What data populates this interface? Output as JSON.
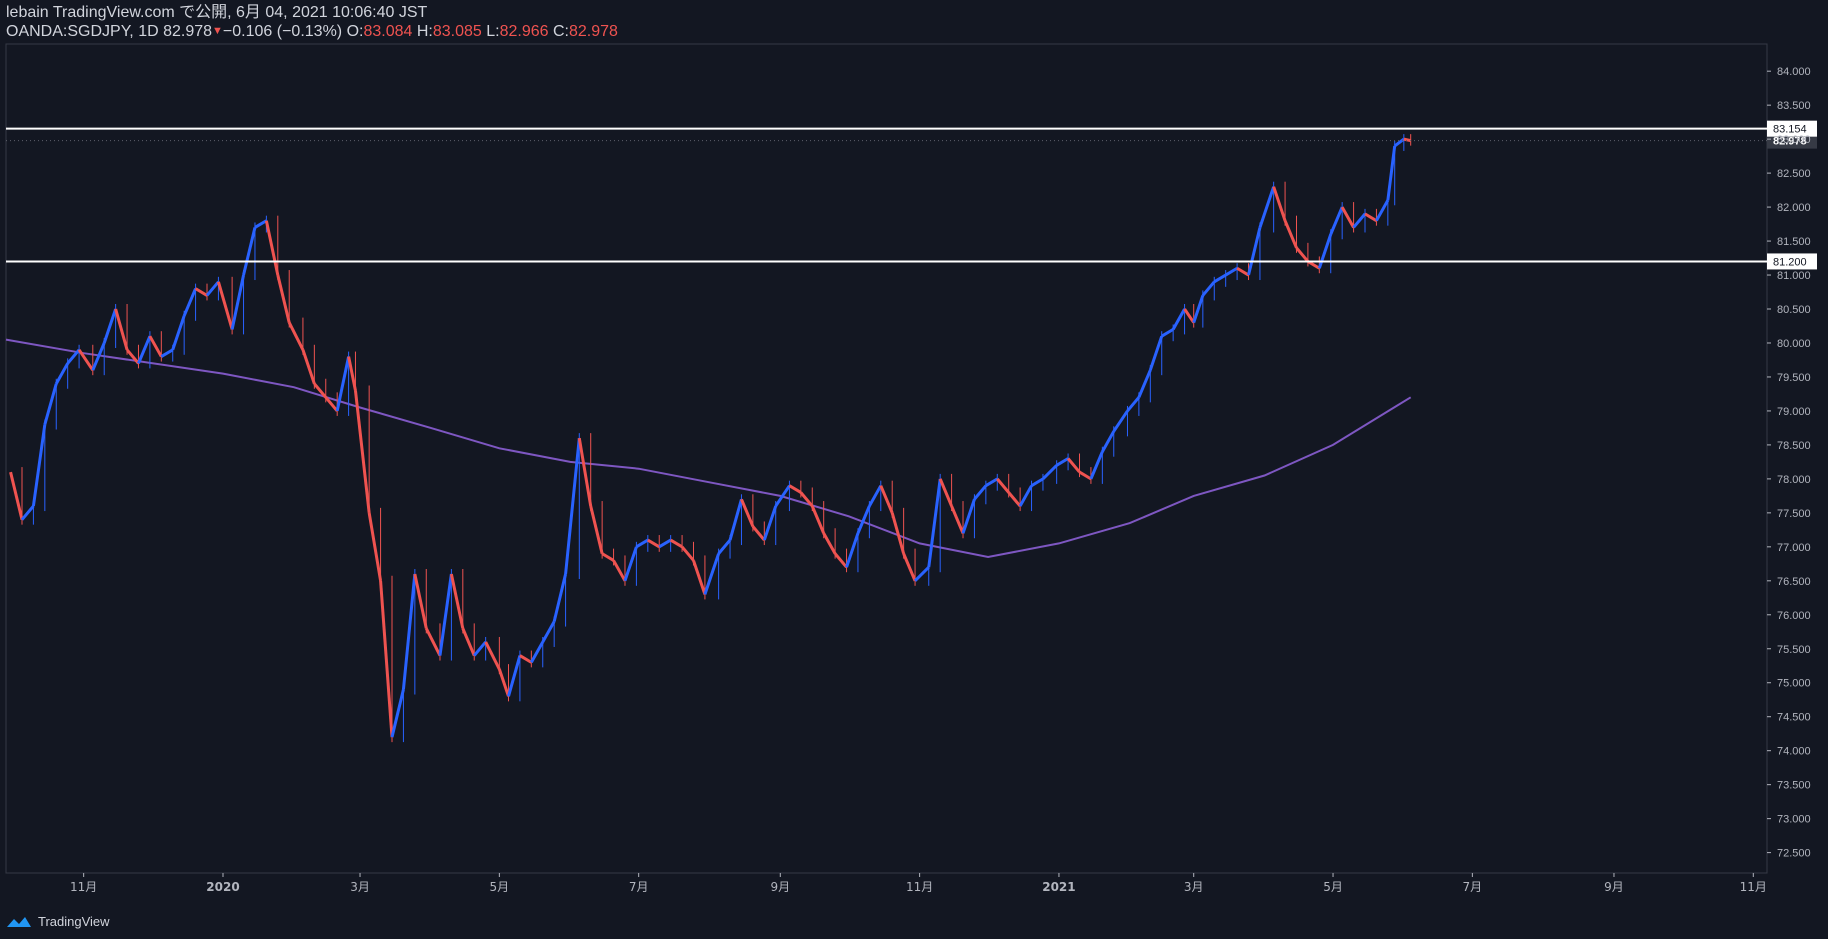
{
  "header": {
    "publish_line": "lebain TradingView.com で公開, 6月 04, 2021 10:06:40 JST",
    "symbol": "OANDA:SGDJPY, 1D",
    "last": "82.978",
    "change": "−0.106 (−0.13%)",
    "o_label": "O:",
    "o_value": "83.084",
    "h_label": "H:",
    "h_value": "83.085",
    "l_label": "L:",
    "l_value": "82.966",
    "c_label": "C:",
    "c_value": "82.978"
  },
  "footer": {
    "brand": "TradingView"
  },
  "colors": {
    "up": "#2962ff",
    "down": "#ef5350",
    "ma": "#7e57c2",
    "bg": "#131722",
    "line": "#ffffff"
  },
  "chart_data": {
    "type": "line",
    "title": "OANDA:SGDJPY, 1D",
    "ylim": [
      72.2,
      84.4
    ],
    "y_ticks": [
      "72.500",
      "73.000",
      "73.500",
      "74.000",
      "74.500",
      "75.000",
      "75.500",
      "76.000",
      "76.500",
      "77.000",
      "77.500",
      "78.000",
      "78.500",
      "79.000",
      "79.500",
      "80.000",
      "80.500",
      "81.000",
      "81.500",
      "82.000",
      "82.500",
      "83.000",
      "83.500",
      "84.000"
    ],
    "x_ticks": [
      {
        "label": "11月",
        "date": "2019-11-01"
      },
      {
        "label": "2020",
        "date": "2020-01-01"
      },
      {
        "label": "3月",
        "date": "2020-03-01"
      },
      {
        "label": "5月",
        "date": "2020-05-01"
      },
      {
        "label": "7月",
        "date": "2020-07-01"
      },
      {
        "label": "9月",
        "date": "2020-09-01"
      },
      {
        "label": "11月",
        "date": "2020-11-01"
      },
      {
        "label": "2021",
        "date": "2021-01-01"
      },
      {
        "label": "3月",
        "date": "2021-03-01"
      },
      {
        "label": "5月",
        "date": "2021-05-01"
      },
      {
        "label": "7月",
        "date": "2021-07-01"
      },
      {
        "label": "9月",
        "date": "2021-09-01"
      },
      {
        "label": "11月",
        "date": "2021-11-01"
      }
    ],
    "x_range": [
      "2019-09-28",
      "2021-11-07"
    ],
    "price_line": {
      "value": 82.978,
      "label": "82.978"
    },
    "horizontal_lines": [
      {
        "value": 83.154,
        "label": "83.154"
      },
      {
        "value": 81.2,
        "label": "81.200"
      }
    ],
    "series": [
      {
        "type": "close",
        "points": [
          [
            "2019-09-30",
            78.1
          ],
          [
            "2019-10-05",
            77.4
          ],
          [
            "2019-10-10",
            77.6
          ],
          [
            "2019-10-15",
            78.8
          ],
          [
            "2019-10-20",
            79.4
          ],
          [
            "2019-10-25",
            79.7
          ],
          [
            "2019-10-30",
            79.9
          ],
          [
            "2019-11-05",
            79.6
          ],
          [
            "2019-11-10",
            80.0
          ],
          [
            "2019-11-15",
            80.5
          ],
          [
            "2019-11-20",
            79.9
          ],
          [
            "2019-11-25",
            79.7
          ],
          [
            "2019-11-30",
            80.1
          ],
          [
            "2019-12-05",
            79.8
          ],
          [
            "2019-12-10",
            79.9
          ],
          [
            "2019-12-15",
            80.4
          ],
          [
            "2019-12-20",
            80.8
          ],
          [
            "2019-12-25",
            80.7
          ],
          [
            "2019-12-30",
            80.9
          ],
          [
            "2020-01-05",
            80.2
          ],
          [
            "2020-01-10",
            81.0
          ],
          [
            "2020-01-15",
            81.7
          ],
          [
            "2020-01-20",
            81.8
          ],
          [
            "2020-01-25",
            81.0
          ],
          [
            "2020-01-30",
            80.3
          ],
          [
            "2020-02-05",
            79.9
          ],
          [
            "2020-02-10",
            79.4
          ],
          [
            "2020-02-15",
            79.2
          ],
          [
            "2020-02-20",
            79.0
          ],
          [
            "2020-02-25",
            79.8
          ],
          [
            "2020-02-28",
            79.3
          ],
          [
            "2020-03-05",
            77.5
          ],
          [
            "2020-03-10",
            76.5
          ],
          [
            "2020-03-15",
            74.2
          ],
          [
            "2020-03-20",
            74.9
          ],
          [
            "2020-03-25",
            76.6
          ],
          [
            "2020-03-30",
            75.8
          ],
          [
            "2020-04-05",
            75.4
          ],
          [
            "2020-04-10",
            76.6
          ],
          [
            "2020-04-15",
            75.8
          ],
          [
            "2020-04-20",
            75.4
          ],
          [
            "2020-04-25",
            75.6
          ],
          [
            "2020-05-01",
            75.2
          ],
          [
            "2020-05-05",
            74.8
          ],
          [
            "2020-05-10",
            75.4
          ],
          [
            "2020-05-15",
            75.3
          ],
          [
            "2020-05-20",
            75.6
          ],
          [
            "2020-05-25",
            75.9
          ],
          [
            "2020-05-30",
            76.6
          ],
          [
            "2020-06-05",
            78.6
          ],
          [
            "2020-06-10",
            77.6
          ],
          [
            "2020-06-15",
            76.9
          ],
          [
            "2020-06-20",
            76.8
          ],
          [
            "2020-06-25",
            76.5
          ],
          [
            "2020-06-30",
            77.0
          ],
          [
            "2020-07-05",
            77.1
          ],
          [
            "2020-07-10",
            77.0
          ],
          [
            "2020-07-15",
            77.1
          ],
          [
            "2020-07-20",
            77.0
          ],
          [
            "2020-07-25",
            76.8
          ],
          [
            "2020-07-30",
            76.3
          ],
          [
            "2020-08-05",
            76.9
          ],
          [
            "2020-08-10",
            77.1
          ],
          [
            "2020-08-15",
            77.7
          ],
          [
            "2020-08-20",
            77.3
          ],
          [
            "2020-08-25",
            77.1
          ],
          [
            "2020-08-30",
            77.6
          ],
          [
            "2020-09-05",
            77.9
          ],
          [
            "2020-09-10",
            77.8
          ],
          [
            "2020-09-15",
            77.6
          ],
          [
            "2020-09-20",
            77.2
          ],
          [
            "2020-09-25",
            76.9
          ],
          [
            "2020-09-30",
            76.7
          ],
          [
            "2020-10-05",
            77.2
          ],
          [
            "2020-10-10",
            77.6
          ],
          [
            "2020-10-15",
            77.9
          ],
          [
            "2020-10-20",
            77.5
          ],
          [
            "2020-10-25",
            76.9
          ],
          [
            "2020-10-30",
            76.5
          ],
          [
            "2020-11-05",
            76.7
          ],
          [
            "2020-11-10",
            78.0
          ],
          [
            "2020-11-15",
            77.6
          ],
          [
            "2020-11-20",
            77.2
          ],
          [
            "2020-11-25",
            77.7
          ],
          [
            "2020-11-30",
            77.9
          ],
          [
            "2020-12-05",
            78.0
          ],
          [
            "2020-12-10",
            77.8
          ],
          [
            "2020-12-15",
            77.6
          ],
          [
            "2020-12-20",
            77.9
          ],
          [
            "2020-12-25",
            78.0
          ],
          [
            "2020-12-31",
            78.2
          ],
          [
            "2021-01-05",
            78.3
          ],
          [
            "2021-01-10",
            78.1
          ],
          [
            "2021-01-15",
            78.0
          ],
          [
            "2021-01-20",
            78.4
          ],
          [
            "2021-01-25",
            78.7
          ],
          [
            "2021-01-31",
            79.0
          ],
          [
            "2021-02-05",
            79.2
          ],
          [
            "2021-02-10",
            79.6
          ],
          [
            "2021-02-15",
            80.1
          ],
          [
            "2021-02-20",
            80.2
          ],
          [
            "2021-02-25",
            80.5
          ],
          [
            "2021-03-01",
            80.3
          ],
          [
            "2021-03-05",
            80.7
          ],
          [
            "2021-03-10",
            80.9
          ],
          [
            "2021-03-15",
            81.0
          ],
          [
            "2021-03-20",
            81.1
          ],
          [
            "2021-03-25",
            81.0
          ],
          [
            "2021-03-30",
            81.7
          ],
          [
            "2021-04-05",
            82.3
          ],
          [
            "2021-04-10",
            81.8
          ],
          [
            "2021-04-15",
            81.4
          ],
          [
            "2021-04-20",
            81.2
          ],
          [
            "2021-04-25",
            81.1
          ],
          [
            "2021-04-30",
            81.6
          ],
          [
            "2021-05-05",
            82.0
          ],
          [
            "2021-05-10",
            81.7
          ],
          [
            "2021-05-15",
            81.9
          ],
          [
            "2021-05-20",
            81.8
          ],
          [
            "2021-05-25",
            82.1
          ],
          [
            "2021-05-28",
            82.9
          ],
          [
            "2021-06-01",
            83.0
          ],
          [
            "2021-06-04",
            82.978
          ]
        ]
      },
      {
        "type": "moving-average",
        "points": [
          [
            "2019-09-28",
            80.05
          ],
          [
            "2019-11-01",
            79.85
          ],
          [
            "2020-01-01",
            79.55
          ],
          [
            "2020-02-01",
            79.35
          ],
          [
            "2020-03-01",
            79.05
          ],
          [
            "2020-04-01",
            78.75
          ],
          [
            "2020-05-01",
            78.45
          ],
          [
            "2020-06-01",
            78.25
          ],
          [
            "2020-07-01",
            78.15
          ],
          [
            "2020-08-01",
            77.95
          ],
          [
            "2020-09-01",
            77.75
          ],
          [
            "2020-10-01",
            77.45
          ],
          [
            "2020-11-01",
            77.05
          ],
          [
            "2020-12-01",
            76.85
          ],
          [
            "2021-01-01",
            77.05
          ],
          [
            "2021-02-01",
            77.35
          ],
          [
            "2021-03-01",
            77.75
          ],
          [
            "2021-04-01",
            78.05
          ],
          [
            "2021-05-01",
            78.5
          ],
          [
            "2021-06-04",
            79.2
          ]
        ]
      }
    ]
  }
}
